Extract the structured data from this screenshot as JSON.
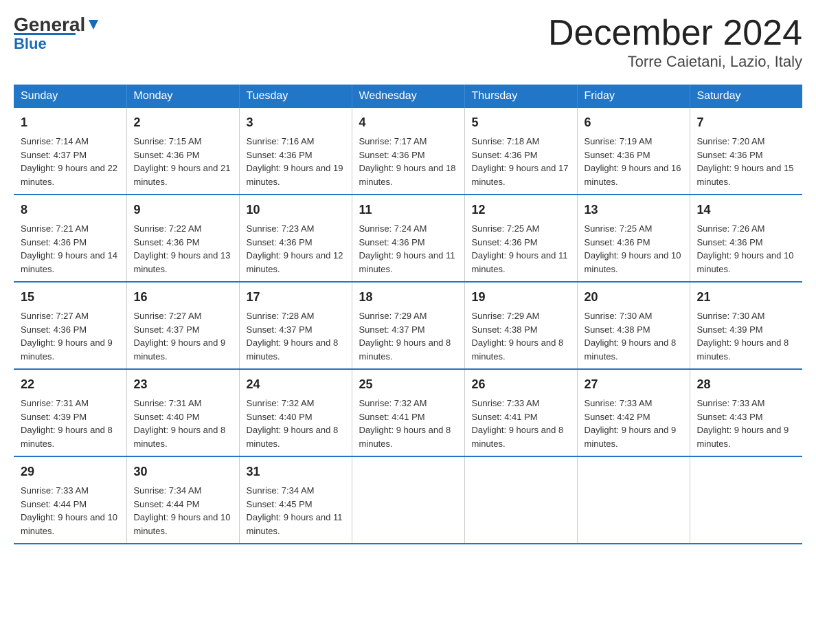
{
  "header": {
    "logo_general": "General",
    "logo_blue": "Blue",
    "month": "December 2024",
    "location": "Torre Caietani, Lazio, Italy"
  },
  "weekdays": [
    "Sunday",
    "Monday",
    "Tuesday",
    "Wednesday",
    "Thursday",
    "Friday",
    "Saturday"
  ],
  "weeks": [
    [
      {
        "day": "1",
        "sunrise": "Sunrise: 7:14 AM",
        "sunset": "Sunset: 4:37 PM",
        "daylight": "Daylight: 9 hours and 22 minutes."
      },
      {
        "day": "2",
        "sunrise": "Sunrise: 7:15 AM",
        "sunset": "Sunset: 4:36 PM",
        "daylight": "Daylight: 9 hours and 21 minutes."
      },
      {
        "day": "3",
        "sunrise": "Sunrise: 7:16 AM",
        "sunset": "Sunset: 4:36 PM",
        "daylight": "Daylight: 9 hours and 19 minutes."
      },
      {
        "day": "4",
        "sunrise": "Sunrise: 7:17 AM",
        "sunset": "Sunset: 4:36 PM",
        "daylight": "Daylight: 9 hours and 18 minutes."
      },
      {
        "day": "5",
        "sunrise": "Sunrise: 7:18 AM",
        "sunset": "Sunset: 4:36 PM",
        "daylight": "Daylight: 9 hours and 17 minutes."
      },
      {
        "day": "6",
        "sunrise": "Sunrise: 7:19 AM",
        "sunset": "Sunset: 4:36 PM",
        "daylight": "Daylight: 9 hours and 16 minutes."
      },
      {
        "day": "7",
        "sunrise": "Sunrise: 7:20 AM",
        "sunset": "Sunset: 4:36 PM",
        "daylight": "Daylight: 9 hours and 15 minutes."
      }
    ],
    [
      {
        "day": "8",
        "sunrise": "Sunrise: 7:21 AM",
        "sunset": "Sunset: 4:36 PM",
        "daylight": "Daylight: 9 hours and 14 minutes."
      },
      {
        "day": "9",
        "sunrise": "Sunrise: 7:22 AM",
        "sunset": "Sunset: 4:36 PM",
        "daylight": "Daylight: 9 hours and 13 minutes."
      },
      {
        "day": "10",
        "sunrise": "Sunrise: 7:23 AM",
        "sunset": "Sunset: 4:36 PM",
        "daylight": "Daylight: 9 hours and 12 minutes."
      },
      {
        "day": "11",
        "sunrise": "Sunrise: 7:24 AM",
        "sunset": "Sunset: 4:36 PM",
        "daylight": "Daylight: 9 hours and 11 minutes."
      },
      {
        "day": "12",
        "sunrise": "Sunrise: 7:25 AM",
        "sunset": "Sunset: 4:36 PM",
        "daylight": "Daylight: 9 hours and 11 minutes."
      },
      {
        "day": "13",
        "sunrise": "Sunrise: 7:25 AM",
        "sunset": "Sunset: 4:36 PM",
        "daylight": "Daylight: 9 hours and 10 minutes."
      },
      {
        "day": "14",
        "sunrise": "Sunrise: 7:26 AM",
        "sunset": "Sunset: 4:36 PM",
        "daylight": "Daylight: 9 hours and 10 minutes."
      }
    ],
    [
      {
        "day": "15",
        "sunrise": "Sunrise: 7:27 AM",
        "sunset": "Sunset: 4:36 PM",
        "daylight": "Daylight: 9 hours and 9 minutes."
      },
      {
        "day": "16",
        "sunrise": "Sunrise: 7:27 AM",
        "sunset": "Sunset: 4:37 PM",
        "daylight": "Daylight: 9 hours and 9 minutes."
      },
      {
        "day": "17",
        "sunrise": "Sunrise: 7:28 AM",
        "sunset": "Sunset: 4:37 PM",
        "daylight": "Daylight: 9 hours and 8 minutes."
      },
      {
        "day": "18",
        "sunrise": "Sunrise: 7:29 AM",
        "sunset": "Sunset: 4:37 PM",
        "daylight": "Daylight: 9 hours and 8 minutes."
      },
      {
        "day": "19",
        "sunrise": "Sunrise: 7:29 AM",
        "sunset": "Sunset: 4:38 PM",
        "daylight": "Daylight: 9 hours and 8 minutes."
      },
      {
        "day": "20",
        "sunrise": "Sunrise: 7:30 AM",
        "sunset": "Sunset: 4:38 PM",
        "daylight": "Daylight: 9 hours and 8 minutes."
      },
      {
        "day": "21",
        "sunrise": "Sunrise: 7:30 AM",
        "sunset": "Sunset: 4:39 PM",
        "daylight": "Daylight: 9 hours and 8 minutes."
      }
    ],
    [
      {
        "day": "22",
        "sunrise": "Sunrise: 7:31 AM",
        "sunset": "Sunset: 4:39 PM",
        "daylight": "Daylight: 9 hours and 8 minutes."
      },
      {
        "day": "23",
        "sunrise": "Sunrise: 7:31 AM",
        "sunset": "Sunset: 4:40 PM",
        "daylight": "Daylight: 9 hours and 8 minutes."
      },
      {
        "day": "24",
        "sunrise": "Sunrise: 7:32 AM",
        "sunset": "Sunset: 4:40 PM",
        "daylight": "Daylight: 9 hours and 8 minutes."
      },
      {
        "day": "25",
        "sunrise": "Sunrise: 7:32 AM",
        "sunset": "Sunset: 4:41 PM",
        "daylight": "Daylight: 9 hours and 8 minutes."
      },
      {
        "day": "26",
        "sunrise": "Sunrise: 7:33 AM",
        "sunset": "Sunset: 4:41 PM",
        "daylight": "Daylight: 9 hours and 8 minutes."
      },
      {
        "day": "27",
        "sunrise": "Sunrise: 7:33 AM",
        "sunset": "Sunset: 4:42 PM",
        "daylight": "Daylight: 9 hours and 9 minutes."
      },
      {
        "day": "28",
        "sunrise": "Sunrise: 7:33 AM",
        "sunset": "Sunset: 4:43 PM",
        "daylight": "Daylight: 9 hours and 9 minutes."
      }
    ],
    [
      {
        "day": "29",
        "sunrise": "Sunrise: 7:33 AM",
        "sunset": "Sunset: 4:44 PM",
        "daylight": "Daylight: 9 hours and 10 minutes."
      },
      {
        "day": "30",
        "sunrise": "Sunrise: 7:34 AM",
        "sunset": "Sunset: 4:44 PM",
        "daylight": "Daylight: 9 hours and 10 minutes."
      },
      {
        "day": "31",
        "sunrise": "Sunrise: 7:34 AM",
        "sunset": "Sunset: 4:45 PM",
        "daylight": "Daylight: 9 hours and 11 minutes."
      },
      {
        "day": "",
        "sunrise": "",
        "sunset": "",
        "daylight": ""
      },
      {
        "day": "",
        "sunrise": "",
        "sunset": "",
        "daylight": ""
      },
      {
        "day": "",
        "sunrise": "",
        "sunset": "",
        "daylight": ""
      },
      {
        "day": "",
        "sunrise": "",
        "sunset": "",
        "daylight": ""
      }
    ]
  ]
}
